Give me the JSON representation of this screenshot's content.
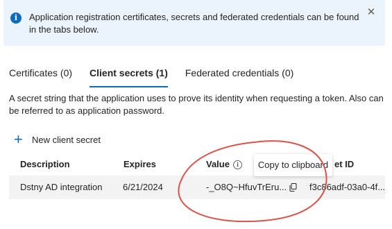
{
  "banner": {
    "text": "Application registration certificates, secrets and federated credentials can be found in the tabs below."
  },
  "tabs": [
    {
      "label": "Certificates (0)"
    },
    {
      "label": "Client secrets (1)"
    },
    {
      "label": "Federated credentials (0)"
    }
  ],
  "description": "A secret string that the application uses to prove its identity when requesting a token. Also can be referred to as application password.",
  "toolbar": {
    "new_secret_label": "New client secret"
  },
  "table": {
    "columns": [
      "Description",
      "Expires",
      "Value",
      "et ID"
    ],
    "rows": [
      {
        "description": "Dstny AD integration",
        "expires": "6/21/2024",
        "value": "-_O8Q~HfuvTrEru...",
        "secret_id": "f3c86adf-03a0-4f..."
      }
    ]
  },
  "tooltip": {
    "text": "Copy to clipboard"
  },
  "colors": {
    "accent": "#0f6cbd",
    "annotation": "#d9534a"
  }
}
